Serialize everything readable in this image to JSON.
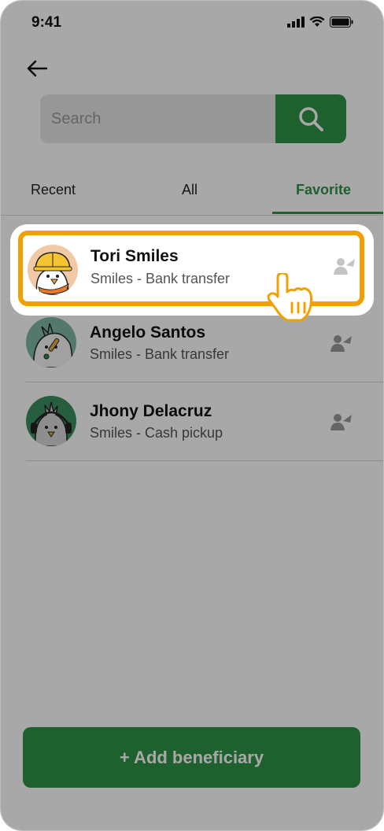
{
  "status_bar": {
    "time": "9:41"
  },
  "search": {
    "placeholder": "Search"
  },
  "tabs": [
    {
      "label": "Recent",
      "active": false
    },
    {
      "label": "All",
      "active": false
    },
    {
      "label": "Favorite",
      "active": true
    }
  ],
  "beneficiaries": [
    {
      "name": "Tori Smiles",
      "detail": "Smiles - Bank transfer",
      "avatar_icon": "bird-hardhat-icon",
      "highlighted": true
    },
    {
      "name": "Angelo Santos",
      "detail": "Smiles - Bank transfer",
      "avatar_icon": "bird-microphone-icon",
      "highlighted": false
    },
    {
      "name": "Jhony Delacruz",
      "detail": "Smiles - Cash pickup",
      "avatar_icon": "bird-headphones-icon",
      "highlighted": false
    }
  ],
  "add_button": {
    "label": "+ Add beneficiary"
  },
  "colors": {
    "accent": "#2e9447",
    "highlight": "#f0a000",
    "overlay": "rgba(0,0,0,0.34)"
  }
}
